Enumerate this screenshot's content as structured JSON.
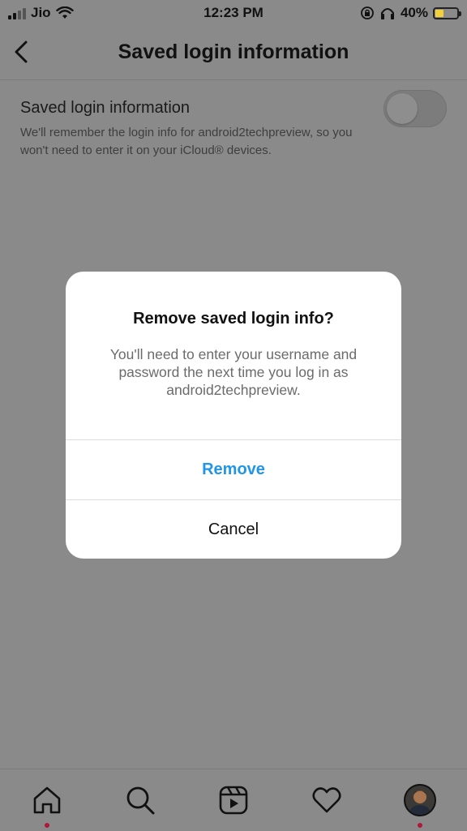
{
  "status_bar": {
    "carrier": "Jio",
    "time": "12:23 PM",
    "battery_percent": "40%",
    "battery_level": 0.4,
    "icons": [
      "signal-icon",
      "wifi-icon",
      "rotation-lock-icon",
      "headphones-icon",
      "battery-icon"
    ]
  },
  "header": {
    "title": "Saved login information",
    "back_icon": "chevron-left-icon"
  },
  "setting": {
    "title": "Saved login information",
    "description": "We'll remember the login info for android2techpreview, so you won't need to enter it on your iCloud® devices.",
    "toggle_on": false
  },
  "dialog": {
    "title": "Remove saved login info?",
    "message": "You'll need to enter your username and password the next time you log in as android2techpreview.",
    "remove_label": "Remove",
    "cancel_label": "Cancel",
    "accent_color": "#2196e8"
  },
  "bottom_nav": {
    "items": [
      "home-icon",
      "search-icon",
      "reels-icon",
      "heart-icon",
      "profile-avatar"
    ],
    "notification_dot_color": "#b0183a"
  }
}
